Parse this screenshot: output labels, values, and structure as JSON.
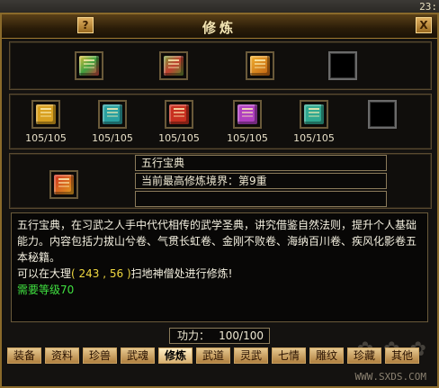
{
  "clock": "23:",
  "window": {
    "title": "修炼",
    "help_label": "?",
    "close_label": "X"
  },
  "top_row_icons": [
    {
      "icon": "rainbow-scroll-icon",
      "color": "#b07a20"
    },
    {
      "icon": "jade-bundle-icon",
      "color": "#5a8a30"
    },
    {
      "icon": "gold-treasure-icon",
      "color": "#d08a20"
    },
    {
      "icon": "empty-slot",
      "color": ""
    }
  ],
  "books": [
    {
      "icon": "yellow-book-icon",
      "color": "#d8a020",
      "count": "105/105"
    },
    {
      "icon": "teal-book-icon",
      "color": "#2aa0a0",
      "count": "105/105"
    },
    {
      "icon": "red-book-icon",
      "color": "#c83020",
      "count": "105/105"
    },
    {
      "icon": "purple-book-icon",
      "color": "#b040c0",
      "count": "105/105"
    },
    {
      "icon": "cyan-book-icon",
      "color": "#30a890",
      "count": "105/105"
    },
    {
      "icon": "empty-slot",
      "color": "",
      "count": ""
    }
  ],
  "selected": {
    "icon": "five-elements-book-icon",
    "name": "五行宝典",
    "realm": "当前最高修炼境界：第9重",
    "extra": ""
  },
  "description": {
    "line1": "五行宝典，在习武之人手中代代相传的武学圣典，讲究借鉴自然法则，提升个人基础能力。内容包括力拔山兮卷、气贯长虹卷、金刚不败卷、海纳百川卷、疾风化影卷五本秘籍。",
    "loc_prefix": "可以在大理",
    "loc_coords": "( 243 , 56 )",
    "loc_suffix": "扫地神僧处进行修炼!",
    "requirement": "需要等级70"
  },
  "power": {
    "label": "功力：",
    "value": "100/100"
  },
  "tabs": [
    "装备",
    "资料",
    "珍兽",
    "武魂",
    "修炼",
    "武道",
    "灵武",
    "七情",
    "雕纹",
    "珍藏",
    "其他"
  ],
  "active_tab": "修炼",
  "watermark": "WWW.SXDS.COM"
}
